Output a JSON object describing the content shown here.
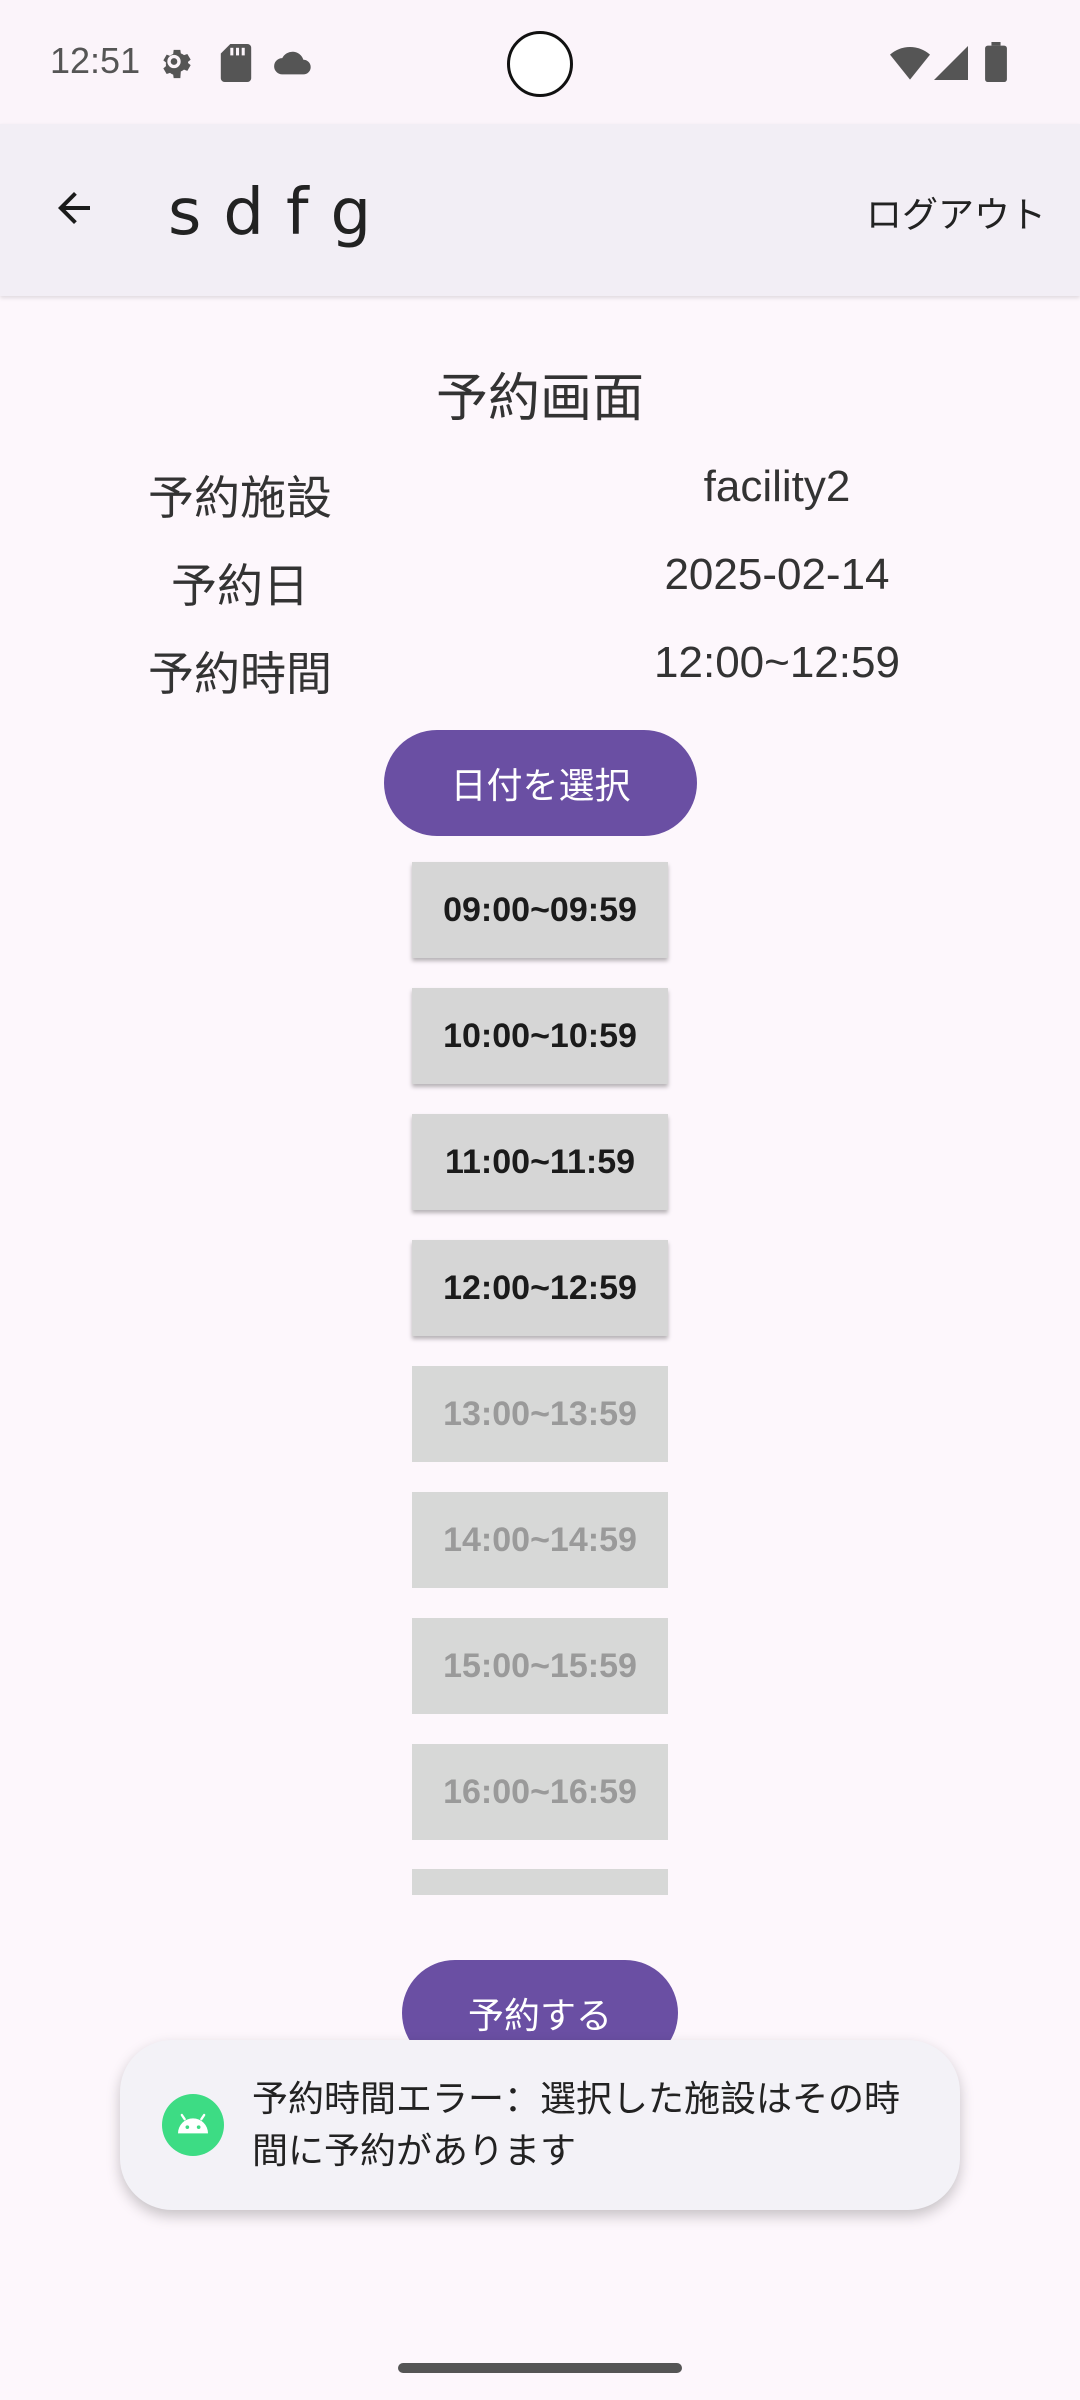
{
  "status_bar": {
    "time": "12:51",
    "icons": [
      "settings-icon",
      "sd-card-icon",
      "cloud-icon",
      "wifi-icon",
      "signal-icon",
      "battery-icon"
    ]
  },
  "app_bar": {
    "title": "sdfg",
    "logout_label": "ログアウト"
  },
  "main": {
    "title": "予約画面",
    "rows": [
      {
        "label": "予約施設",
        "value": "facility2"
      },
      {
        "label": "予約日",
        "value": "2025-02-14"
      },
      {
        "label": "予約時間",
        "value": "12:00~12:59"
      }
    ],
    "date_button_label": "日付を選択",
    "time_slots": [
      {
        "label": "09:00~09:59",
        "enabled": true
      },
      {
        "label": "10:00~10:59",
        "enabled": true
      },
      {
        "label": "11:00~11:59",
        "enabled": true
      },
      {
        "label": "12:00~12:59",
        "enabled": true
      },
      {
        "label": "13:00~13:59",
        "enabled": false
      },
      {
        "label": "14:00~14:59",
        "enabled": false
      },
      {
        "label": "15:00~15:59",
        "enabled": false
      },
      {
        "label": "16:00~16:59",
        "enabled": false
      }
    ],
    "reserve_button_label": "予約する"
  },
  "toast": {
    "message": "予約時間エラー：選択した施設はその時間に予約があります"
  },
  "colors": {
    "accent": "#6a4fa3",
    "app_bar": "#f2eef5",
    "background": "#fdf7fc",
    "slot_bg": "#d6d6d6",
    "android_green": "#3ddc84"
  }
}
